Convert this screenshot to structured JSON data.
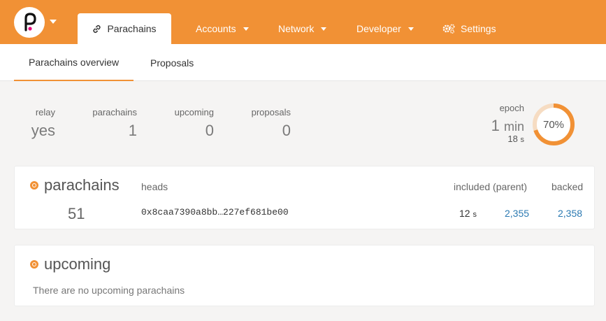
{
  "nav": {
    "active_tab": "Parachains",
    "items": [
      {
        "label": "Accounts"
      },
      {
        "label": "Network"
      },
      {
        "label": "Developer"
      },
      {
        "label": "Settings"
      }
    ]
  },
  "subtabs": [
    "Parachains overview",
    "Proposals"
  ],
  "summary": {
    "relay": {
      "label": "relay",
      "value": "yes"
    },
    "parachains": {
      "label": "parachains",
      "value": "1"
    },
    "upcoming": {
      "label": "upcoming",
      "value": "0"
    },
    "proposals": {
      "label": "proposals",
      "value": "0"
    }
  },
  "epoch": {
    "label": "epoch",
    "minutes": "1",
    "minutes_unit": "min",
    "seconds": "18",
    "seconds_unit": "s",
    "progress_text": "70%",
    "progress": 0.7
  },
  "parachains_card": {
    "title": "parachains",
    "columns": {
      "heads": "heads",
      "included": "included (parent)",
      "backed": "backed"
    },
    "rows": [
      {
        "id": "51",
        "head": "0x8caa7390a8bb…227ef681be00",
        "time": "12",
        "time_unit": "s",
        "included": "2,355",
        "backed": "2,358"
      }
    ]
  },
  "upcoming_card": {
    "title": "upcoming",
    "empty_message": "There are no upcoming parachains"
  },
  "colors": {
    "accent": "#f19135",
    "link": "#2c7ab2"
  }
}
